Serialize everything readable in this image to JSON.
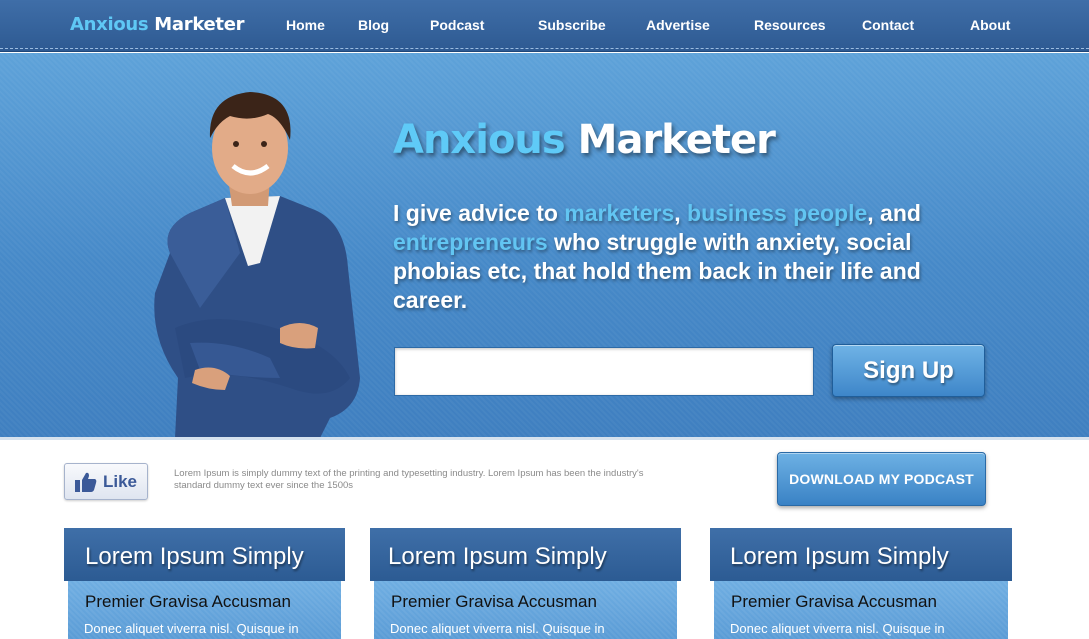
{
  "brand": {
    "name_part1": "Anxious",
    "name_part2": "Marketer"
  },
  "nav": {
    "items": [
      "Home",
      "Blog",
      "Podcast",
      "Subscribe",
      "Advertise",
      "Resources",
      "Contact",
      "About"
    ]
  },
  "hero": {
    "title_part1": "Anxious",
    "title_part2": "Marketer",
    "text": {
      "t1": "I give advice to ",
      "h1": "marketers",
      "t2": ", ",
      "h2": "business people",
      "t3": ", and ",
      "h3": "entrepreneurs",
      "t4": " who struggle with anxiety, social phobias etc, that hold them back in their life and career."
    },
    "email_value": "",
    "signup_label": "Sign Up"
  },
  "strip": {
    "like_label": "Like",
    "text": "Lorem Ipsum is simply dummy text of the printing and typesetting industry. Lorem Ipsum has been the industry's standard dummy text ever since the 1500s",
    "podcast_button": "DOWNLOAD MY PODCAST"
  },
  "cards": [
    {
      "title": "Lorem Ipsum Simply",
      "subtitle": "Premier Gravisa Accusman",
      "text": "Donec aliquet viverra nisl. Quisque in"
    },
    {
      "title": "Lorem Ipsum Simply",
      "subtitle": "Premier Gravisa Accusman",
      "text": "Donec aliquet viverra nisl. Quisque in"
    },
    {
      "title": "Lorem Ipsum Simply",
      "subtitle": "Premier Gravisa Accusman",
      "text": "Donec aliquet viverra nisl. Quisque in"
    }
  ],
  "colors": {
    "nav_bg": "#35659e",
    "hero_bg": "#4a8cca",
    "accent_light_blue": "#5fc8f5",
    "button_blue": "#4a90cf"
  },
  "icons": {
    "like": "thumbs-up-icon",
    "person": "person-illustration"
  }
}
